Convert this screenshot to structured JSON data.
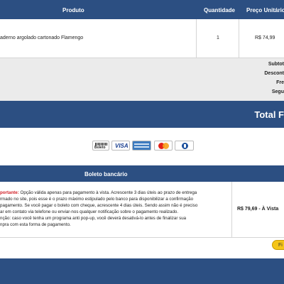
{
  "table_header": {
    "product": "Produto",
    "quantity": "Quantidade",
    "unit_price": "Preço Unitário"
  },
  "item": {
    "name": "aderno argolado cartonado Flamengo",
    "quantity": "1",
    "price": "R$ 74,99"
  },
  "totals": {
    "subtotal": "Subtot",
    "discount": "Descont",
    "shipping": "Fre",
    "insurance": "Segu"
  },
  "total_label": "Total F",
  "payment_methods": [
    "Boleto",
    "VISA",
    "American Express",
    "MasterCard",
    "Diners Club"
  ],
  "boleto": {
    "title": "Boleto bancário",
    "important_label": "portante:",
    "lines": [
      " Opção válida apenas para pagamento à vista. Acrescente 3 dias úteis ao prazo de entrega",
      "rmado no site, pois esse é o prazo máximo estipulado pelo banco para disponibilizar a confirmação",
      "pagamento. Se você pagar o boleto com cheque, acrescente 4 dias úteis. Sendo assim não é preciso",
      "ar em contato via telefone ou enviar-nos qualquer notificação sobre o pagamento realizado.",
      "nção: caso você tenha um programa anti pop-up, você deverá desativá-lo antes de finalizar sua",
      "npra com esta forma de pagamento."
    ],
    "price": "R$ 79,69 - À Vista",
    "finish_button": "Fi"
  },
  "colors": {
    "header_blue": "#2c4f82",
    "important_red": "#d2232a",
    "button_yellow": "#f5c518"
  }
}
